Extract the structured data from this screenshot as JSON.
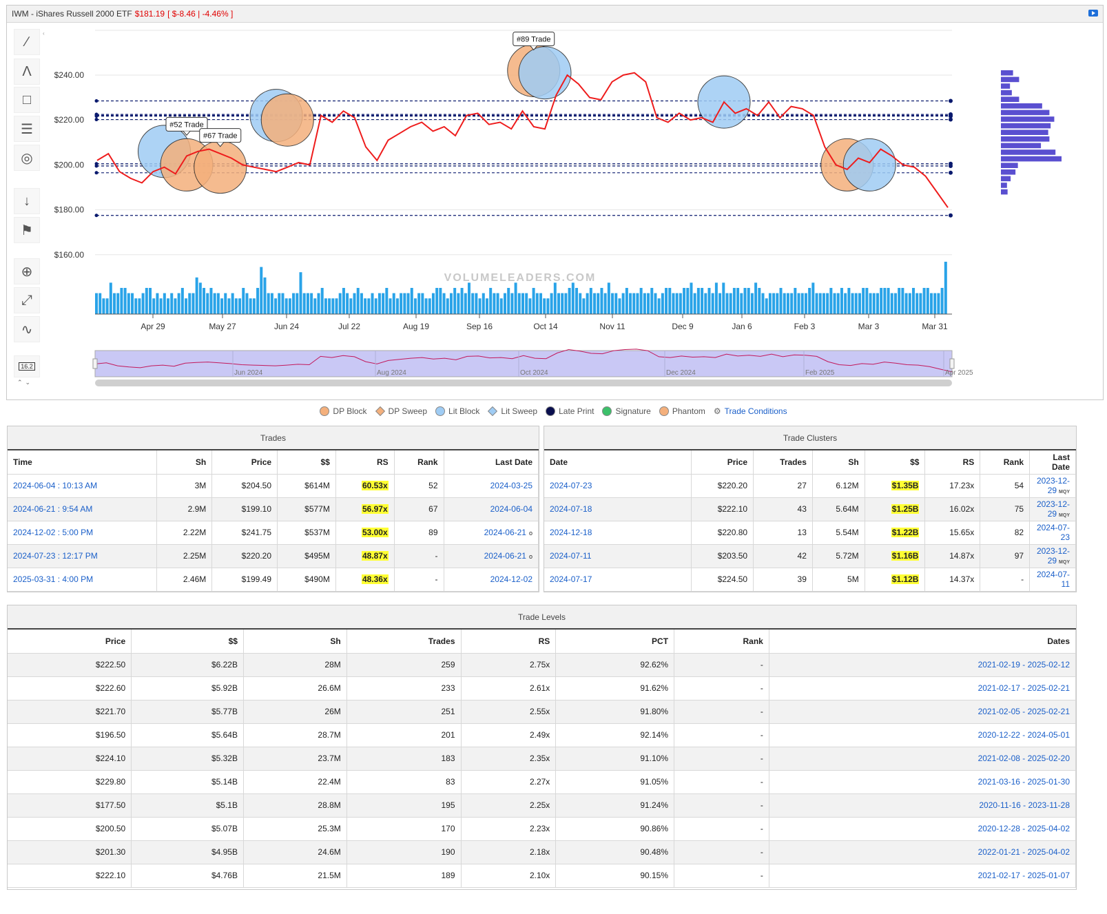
{
  "header": {
    "ticker_name": "IWM - iShares Russell 2000 ETF",
    "price": "$181.19",
    "change": "[ $-8.46 | -4.46% ]"
  },
  "chart_data": {
    "type": "line",
    "series": [
      {
        "values": [
          202,
          205,
          197,
          194,
          192,
          197,
          199,
          196,
          204,
          206,
          207,
          205,
          203,
          200,
          199,
          198,
          197,
          199,
          201,
          200,
          222,
          219,
          224,
          221,
          208,
          202,
          211,
          214,
          217,
          219,
          215,
          217,
          213,
          222,
          223,
          218,
          219,
          216,
          224,
          217,
          216,
          231,
          240,
          236,
          230,
          229,
          237,
          240,
          241,
          237,
          221,
          219,
          223,
          220,
          221,
          219,
          228,
          223,
          225,
          222,
          228,
          221,
          226,
          225,
          222,
          208,
          200,
          198,
          203,
          201,
          207,
          204,
          200,
          199,
          195,
          188,
          181
        ]
      }
    ],
    "y_ticks": [
      "$240.00",
      "$220.00",
      "$200.00",
      "$180.00",
      "$160.00"
    ],
    "x_ticks": [
      "Apr 29",
      "May 27",
      "Jun 24",
      "Jul 22",
      "Aug 19",
      "Sep 16",
      "Oct 14",
      "Nov 11",
      "Dec 9",
      "Jan 6",
      "Feb 3",
      "Mar 3",
      "Mar 31"
    ],
    "level_lines": [
      228.5,
      222.5,
      221.7,
      222.1,
      220.2,
      200.5,
      199.5,
      196.5,
      177.5
    ],
    "bubbles": [
      {
        "kind": "lit",
        "price": 206,
        "date_index": 6
      },
      {
        "kind": "dp",
        "price": 200,
        "date_index": 8
      },
      {
        "kind": "dp",
        "price": 199,
        "date_index": 11
      },
      {
        "kind": "lit",
        "price": 222,
        "date_index": 16
      },
      {
        "kind": "dp",
        "price": 220,
        "date_index": 17
      },
      {
        "kind": "dp",
        "price": 242,
        "date_index": 39
      },
      {
        "kind": "lit",
        "price": 241,
        "date_index": 40
      },
      {
        "kind": "lit",
        "price": 228,
        "date_index": 56
      },
      {
        "kind": "dp",
        "price": 200,
        "date_index": 67
      },
      {
        "kind": "lit",
        "price": 200,
        "date_index": 69
      }
    ],
    "callouts": [
      {
        "text": "#52 Trade",
        "date_index": 8,
        "price": 204
      },
      {
        "text": "#67 Trade",
        "date_index": 11,
        "price": 199
      },
      {
        "text": "#89 Trade",
        "date_index": 39,
        "price": 242
      }
    ],
    "volume_profile": [
      0.2,
      0.3,
      0.15,
      0.18,
      0.3,
      0.68,
      0.8,
      0.88,
      0.82,
      0.78,
      0.8,
      0.66,
      0.9,
      1.0,
      0.28,
      0.24,
      0.16,
      0.1,
      0.11
    ],
    "volume": [
      0.4,
      0.4,
      0.3,
      0.3,
      0.6,
      0.4,
      0.4,
      0.5,
      0.5,
      0.4,
      0.4,
      0.3,
      0.3,
      0.4,
      0.5,
      0.5,
      0.3,
      0.4,
      0.3,
      0.4,
      0.3,
      0.4,
      0.3,
      0.4,
      0.5,
      0.3,
      0.4,
      0.4,
      0.7,
      0.6,
      0.5,
      0.4,
      0.5,
      0.4,
      0.4,
      0.3,
      0.4,
      0.3,
      0.4,
      0.3,
      0.3,
      0.5,
      0.4,
      0.3,
      0.3,
      0.5,
      0.9,
      0.7,
      0.4,
      0.4,
      0.3,
      0.4,
      0.4,
      0.3,
      0.3,
      0.4,
      0.4,
      0.8,
      0.4,
      0.4,
      0.4,
      0.3,
      0.4,
      0.5,
      0.3,
      0.3,
      0.3,
      0.3,
      0.4,
      0.5,
      0.4,
      0.3,
      0.4,
      0.5,
      0.4,
      0.3,
      0.3,
      0.4,
      0.3,
      0.4,
      0.4,
      0.5,
      0.3,
      0.4,
      0.3,
      0.4,
      0.4,
      0.4,
      0.5,
      0.3,
      0.4,
      0.4,
      0.3,
      0.3,
      0.4,
      0.5,
      0.5,
      0.4,
      0.3,
      0.4,
      0.5,
      0.4,
      0.5,
      0.4,
      0.6,
      0.4,
      0.4,
      0.3,
      0.4,
      0.3,
      0.5,
      0.4,
      0.4,
      0.3,
      0.4,
      0.5,
      0.4,
      0.6,
      0.4,
      0.4,
      0.4,
      0.3,
      0.5,
      0.4,
      0.4,
      0.3,
      0.3,
      0.4,
      0.6,
      0.4,
      0.4,
      0.4,
      0.5,
      0.6,
      0.5,
      0.4,
      0.3,
      0.4,
      0.5,
      0.4,
      0.4,
      0.5,
      0.4,
      0.6,
      0.4,
      0.4,
      0.3,
      0.4,
      0.5,
      0.4,
      0.4,
      0.4,
      0.5,
      0.4,
      0.4,
      0.5,
      0.4,
      0.3,
      0.4,
      0.5,
      0.5,
      0.4,
      0.4,
      0.4,
      0.5,
      0.5,
      0.6,
      0.4,
      0.5,
      0.5,
      0.4,
      0.5,
      0.4,
      0.6,
      0.4,
      0.6,
      0.4,
      0.4,
      0.5,
      0.5,
      0.4,
      0.5,
      0.5,
      0.4,
      0.6,
      0.5,
      0.4,
      0.3,
      0.4,
      0.4,
      0.4,
      0.5,
      0.4,
      0.4,
      0.4,
      0.5,
      0.4,
      0.4,
      0.4,
      0.5,
      0.6,
      0.4,
      0.4,
      0.4,
      0.4,
      0.5,
      0.4,
      0.4,
      0.5,
      0.4,
      0.5,
      0.4,
      0.4,
      0.4,
      0.5,
      0.5,
      0.4,
      0.4,
      0.4,
      0.5,
      0.5,
      0.5,
      0.4,
      0.4,
      0.5,
      0.5,
      0.4,
      0.4,
      0.5,
      0.4,
      0.4,
      0.5,
      0.5,
      0.4,
      0.4,
      0.4,
      0.5,
      1.0
    ],
    "navigator_labels": [
      "Jun 2024",
      "Aug 2024",
      "Oct 2024",
      "Dec 2024",
      "Feb 2025",
      "Apr 2025"
    ],
    "watermark": "VOLUMELEADERS.COM",
    "colors": {
      "price_line": "#ee1c1c",
      "level_line": "#0a1a6e",
      "dp": "#f4b07c",
      "lit": "#9fccf4",
      "profile": "#5a4fd0",
      "volume": "#29a3e8",
      "navigator": "#c9c8f5"
    }
  },
  "toolbar": {
    "icons": [
      "trendline-icon",
      "abc-pattern-icon",
      "crosshair-select-icon",
      "grid-lines-icon",
      "hide-eye-icon",
      "sort-123-icon",
      "flag-marker-icon",
      "zoom-target-icon",
      "expand-icon",
      "indicator-icon",
      "visibility-count-icon"
    ],
    "visibility_count": "16.2"
  },
  "legend": {
    "items": [
      "DP Block",
      "DP Sweep",
      "Lit Block",
      "Lit Sweep",
      "Late Print",
      "Signature",
      "Phantom"
    ],
    "colors": [
      "#f4b07c",
      "#f4b07c",
      "#9fccf4",
      "#9fccf4",
      "#0a0f4e",
      "#3cc06a",
      "#f4b07c"
    ],
    "trade_conditions": "Trade Conditions"
  },
  "trades": {
    "title": "Trades",
    "columns": [
      "Time",
      "Sh",
      "Price",
      "$$",
      "RS",
      "Rank",
      "Last Date"
    ],
    "rows": [
      {
        "time": "2024-06-04 : 10:13 AM",
        "sh": "3M",
        "price": "$204.50",
        "dollars": "$614M",
        "rs": "60.53x",
        "rank": "52",
        "last_date": "2024-03-25",
        "mark": ""
      },
      {
        "time": "2024-06-21 : 9:54 AM",
        "sh": "2.9M",
        "price": "$199.10",
        "dollars": "$577M",
        "rs": "56.97x",
        "rank": "67",
        "last_date": "2024-06-04",
        "mark": ""
      },
      {
        "time": "2024-12-02 : 5:00 PM",
        "sh": "2.22M",
        "price": "$241.75",
        "dollars": "$537M",
        "rs": "53.00x",
        "rank": "89",
        "last_date": "2024-06-21",
        "mark": "o"
      },
      {
        "time": "2024-07-23 : 12:17 PM",
        "sh": "2.25M",
        "price": "$220.20",
        "dollars": "$495M",
        "rs": "48.87x",
        "rank": "-",
        "last_date": "2024-06-21",
        "mark": "o"
      },
      {
        "time": "2025-03-31 : 4:00 PM",
        "sh": "2.46M",
        "price": "$199.49",
        "dollars": "$490M",
        "rs": "48.36x",
        "rank": "-",
        "last_date": "2024-12-02",
        "mark": ""
      }
    ]
  },
  "clusters": {
    "title": "Trade Clusters",
    "columns": [
      "Date",
      "Price",
      "Trades",
      "Sh",
      "$$",
      "RS",
      "Rank",
      "Last Date"
    ],
    "rows": [
      {
        "date": "2024-07-23",
        "price": "$220.20",
        "trades": "27",
        "sh": "6.12M",
        "dollars": "$1.35B",
        "rs": "17.23x",
        "rank": "54",
        "last_date": "2023-12-29",
        "tag": "MQY"
      },
      {
        "date": "2024-07-18",
        "price": "$222.10",
        "trades": "43",
        "sh": "5.64M",
        "dollars": "$1.25B",
        "rs": "16.02x",
        "rank": "75",
        "last_date": "2023-12-29",
        "tag": "MQY"
      },
      {
        "date": "2024-12-18",
        "price": "$220.80",
        "trades": "13",
        "sh": "5.54M",
        "dollars": "$1.22B",
        "rs": "15.65x",
        "rank": "82",
        "last_date": "2024-07-23",
        "tag": ""
      },
      {
        "date": "2024-07-11",
        "price": "$203.50",
        "trades": "42",
        "sh": "5.72M",
        "dollars": "$1.16B",
        "rs": "14.87x",
        "rank": "97",
        "last_date": "2023-12-29",
        "tag": "MQY"
      },
      {
        "date": "2024-07-17",
        "price": "$224.50",
        "trades": "39",
        "sh": "5M",
        "dollars": "$1.12B",
        "rs": "14.37x",
        "rank": "-",
        "last_date": "2024-07-11",
        "tag": ""
      }
    ]
  },
  "levels": {
    "title": "Trade Levels",
    "columns": [
      "Price",
      "$$",
      "Sh",
      "Trades",
      "RS",
      "PCT",
      "Rank",
      "Dates"
    ],
    "rows": [
      {
        "price": "$222.50",
        "dollars": "$6.22B",
        "sh": "28M",
        "trades": "259",
        "rs": "2.75x",
        "pct": "92.62%",
        "rank": "-",
        "dates": "2021-02-19 - 2025-02-12"
      },
      {
        "price": "$222.60",
        "dollars": "$5.92B",
        "sh": "26.6M",
        "trades": "233",
        "rs": "2.61x",
        "pct": "91.62%",
        "rank": "-",
        "dates": "2021-02-17 - 2025-02-21"
      },
      {
        "price": "$221.70",
        "dollars": "$5.77B",
        "sh": "26M",
        "trades": "251",
        "rs": "2.55x",
        "pct": "91.80%",
        "rank": "-",
        "dates": "2021-02-05 - 2025-02-21"
      },
      {
        "price": "$196.50",
        "dollars": "$5.64B",
        "sh": "28.7M",
        "trades": "201",
        "rs": "2.49x",
        "pct": "92.14%",
        "rank": "-",
        "dates": "2020-12-22 - 2024-05-01"
      },
      {
        "price": "$224.10",
        "dollars": "$5.32B",
        "sh": "23.7M",
        "trades": "183",
        "rs": "2.35x",
        "pct": "91.10%",
        "rank": "-",
        "dates": "2021-02-08 - 2025-02-20"
      },
      {
        "price": "$229.80",
        "dollars": "$5.14B",
        "sh": "22.4M",
        "trades": "83",
        "rs": "2.27x",
        "pct": "91.05%",
        "rank": "-",
        "dates": "2021-03-16 - 2025-01-30"
      },
      {
        "price": "$177.50",
        "dollars": "$5.1B",
        "sh": "28.8M",
        "trades": "195",
        "rs": "2.25x",
        "pct": "91.24%",
        "rank": "-",
        "dates": "2020-11-16 - 2023-11-28"
      },
      {
        "price": "$200.50",
        "dollars": "$5.07B",
        "sh": "25.3M",
        "trades": "170",
        "rs": "2.23x",
        "pct": "90.86%",
        "rank": "-",
        "dates": "2020-12-28 - 2025-04-02"
      },
      {
        "price": "$201.30",
        "dollars": "$4.95B",
        "sh": "24.6M",
        "trades": "190",
        "rs": "2.18x",
        "pct": "90.48%",
        "rank": "-",
        "dates": "2022-01-21 - 2025-04-02"
      },
      {
        "price": "$222.10",
        "dollars": "$4.76B",
        "sh": "21.5M",
        "trades": "189",
        "rs": "2.10x",
        "pct": "90.15%",
        "rank": "-",
        "dates": "2021-02-17 - 2025-01-07"
      }
    ]
  }
}
